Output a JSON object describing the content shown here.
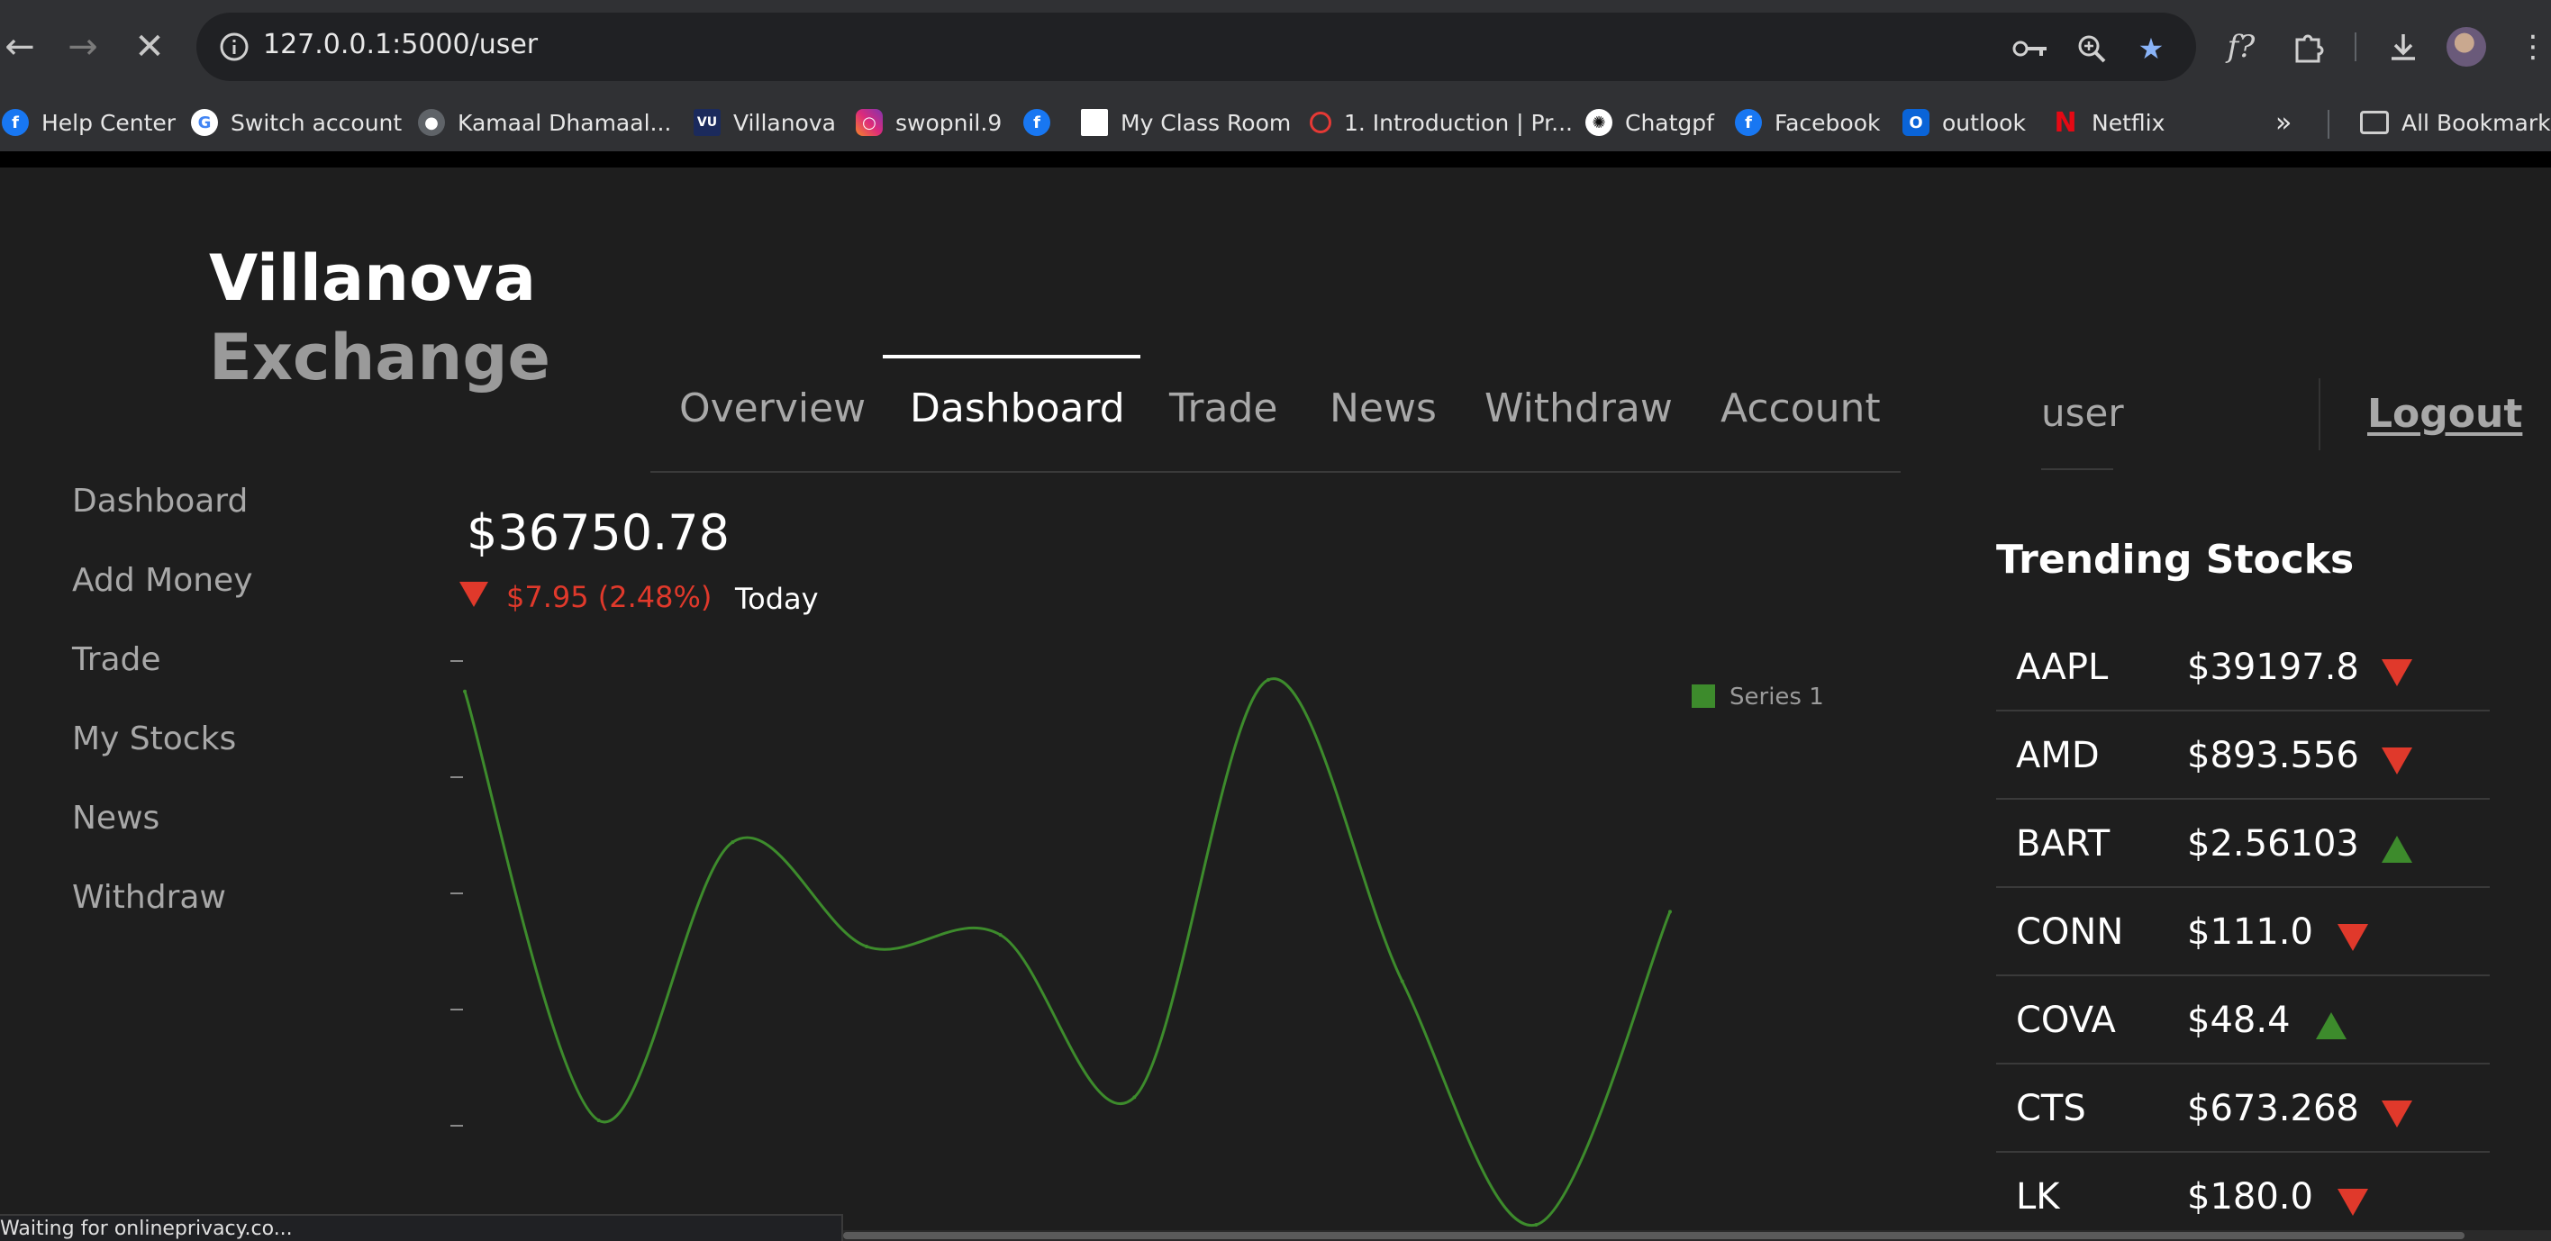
{
  "browser": {
    "url": "127.0.0.1:5000/user",
    "bookmarks": [
      {
        "label": "Help Center",
        "icon": "facebook-icon"
      },
      {
        "label": "Switch account",
        "icon": "google-icon"
      },
      {
        "label": "Kamaal Dhamaal...",
        "icon": "globe-icon"
      },
      {
        "label": "Villanova",
        "icon": "villanova-icon"
      },
      {
        "label": "swopnil.9",
        "icon": "instagram-icon"
      },
      {
        "label": "",
        "icon": "facebook-icon"
      },
      {
        "label": "My Class Room",
        "icon": "blank-page-icon"
      },
      {
        "label": "1. Introduction | Pr...",
        "icon": "opera-icon"
      },
      {
        "label": "Chatgpf",
        "icon": "chatgpt-icon"
      },
      {
        "label": "Facebook",
        "icon": "facebook-icon"
      },
      {
        "label": "outlook",
        "icon": "outlook-icon"
      },
      {
        "label": "Netflix",
        "icon": "netflix-icon"
      }
    ],
    "more_bookmarks": "»",
    "all_bookmarks": "All Bookmarks",
    "status_text": "Waiting for onlineprivacy.co..."
  },
  "app": {
    "brand_line1": "Villanova",
    "brand_line2": "Exchange",
    "nav": [
      "Overview",
      "Dashboard",
      "Trade",
      "News",
      "Withdraw",
      "Account"
    ],
    "active_nav": "Dashboard",
    "user": "user",
    "logout": "Logout",
    "sidebar": [
      "Dashboard",
      "Add Money",
      "Trade",
      "My Stocks",
      "News",
      "Withdraw"
    ],
    "balance": "$36750.78",
    "change": "$7.95 (2.48%)",
    "change_period": "Today",
    "trending_title": "Trending Stocks",
    "stocks": [
      {
        "symbol": "AAPL",
        "price": "$39197.8",
        "direction": "down"
      },
      {
        "symbol": "AMD",
        "price": "$893.556",
        "direction": "down"
      },
      {
        "symbol": "BART",
        "price": "$2.56103",
        "direction": "up"
      },
      {
        "symbol": "CONN",
        "price": "$111.0",
        "direction": "down"
      },
      {
        "symbol": "COVA",
        "price": "$48.4",
        "direction": "up"
      },
      {
        "symbol": "CTS",
        "price": "$673.268",
        "direction": "down"
      },
      {
        "symbol": "LK",
        "price": "$180.0",
        "direction": "down"
      }
    ],
    "colors": {
      "up": "#3d8b2c",
      "down": "#e0392b",
      "series": "#3d8b2c"
    }
  },
  "chart_data": {
    "type": "line",
    "series": [
      {
        "name": "Series 1",
        "values": [
          42,
          5,
          29,
          20,
          21,
          7,
          43,
          17,
          -4,
          23
        ]
      }
    ],
    "ylim": [
      -4,
      44
    ],
    "legend": "top-right",
    "grid": false
  }
}
